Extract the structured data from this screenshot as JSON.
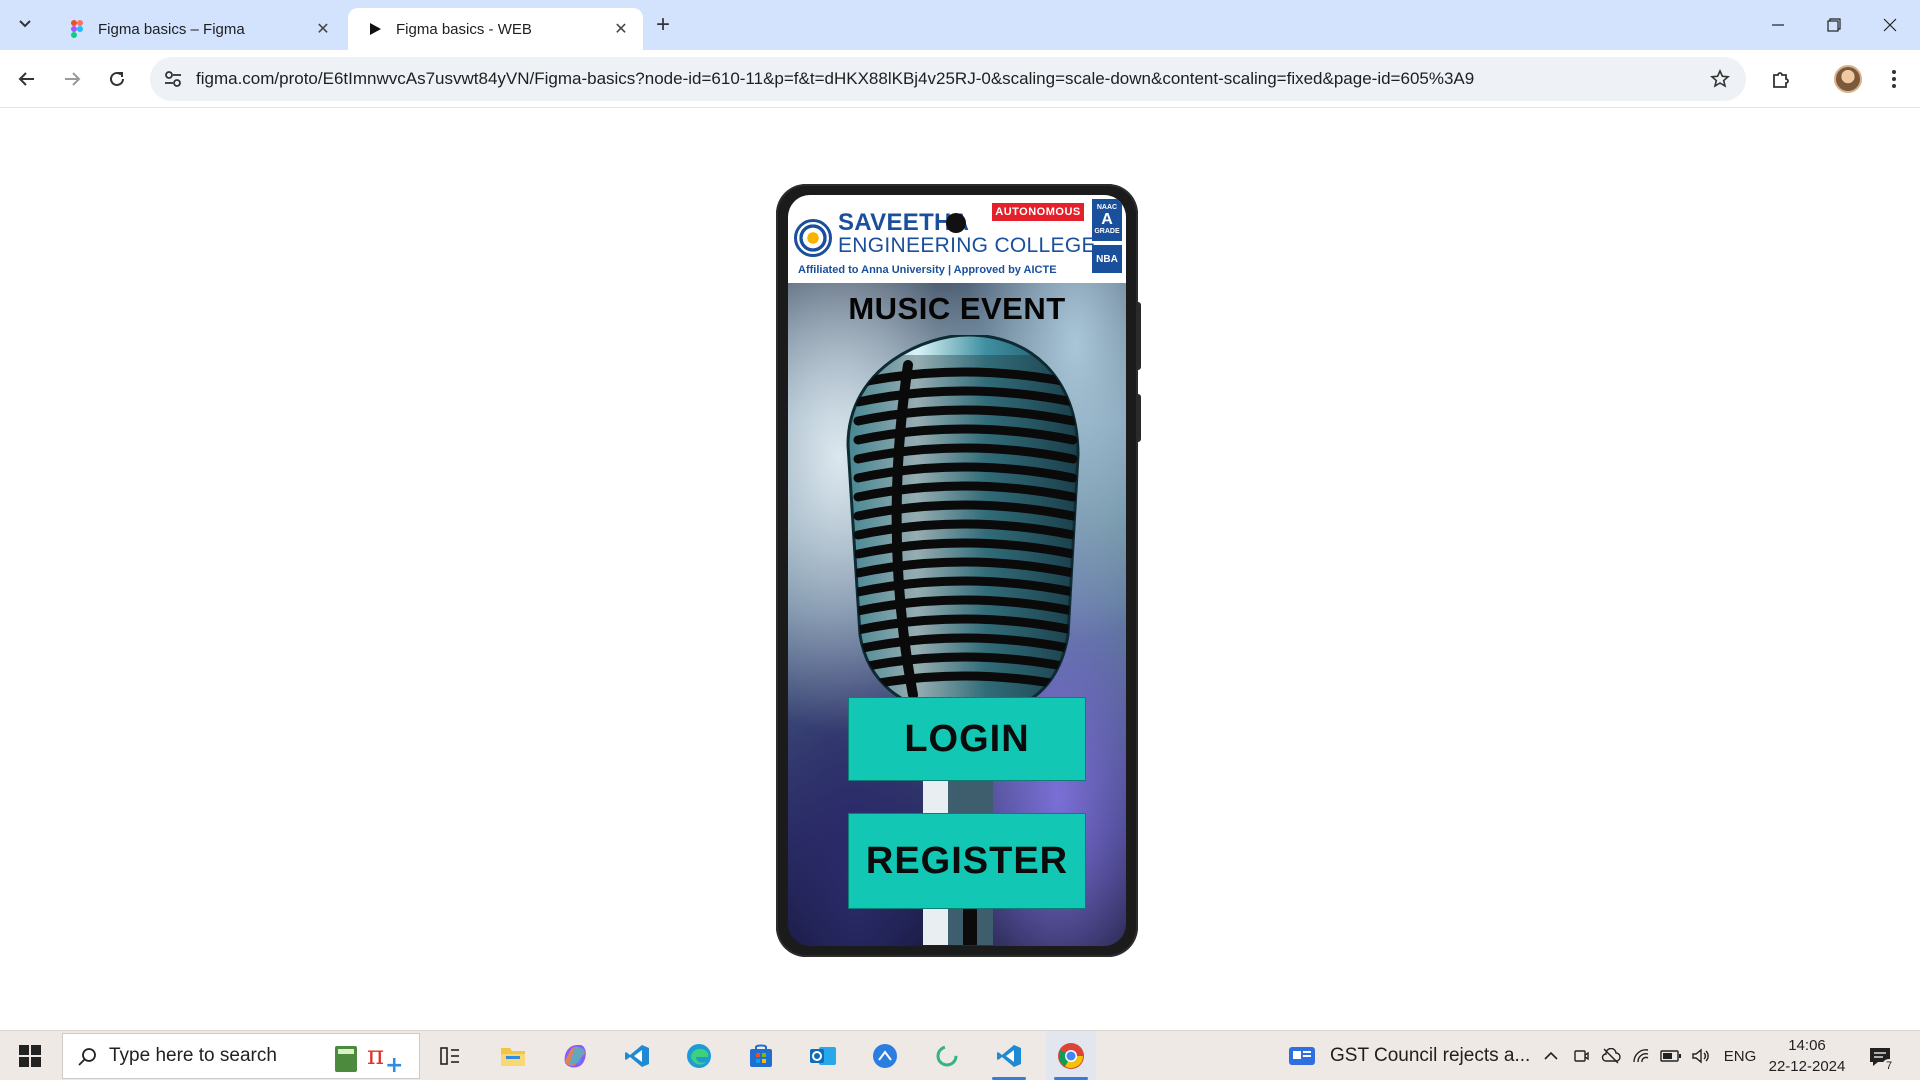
{
  "browser": {
    "tabs": [
      {
        "title": "Figma basics – Figma",
        "active": false
      },
      {
        "title": "Figma basics - WEB",
        "active": true
      }
    ],
    "url": "figma.com/proto/E6tImnwvcAs7usvwt84yVN/Figma-basics?node-id=610-11&p=f&t=dHKX88lKBj4v25RJ-0&scaling=scale-down&content-scaling=fixed&page-id=605%3A9"
  },
  "prototype": {
    "college": {
      "name_line1": "SAVEETHA",
      "name_line2": "ENGINEERING COLLEGE",
      "affiliation": "Affiliated to Anna University | Approved by AICTE",
      "badge": "AUTONOMOUS",
      "naac_label": "NAAC",
      "naac_grade": "A",
      "naac_sub": "GRADE",
      "nba_label": "NBA"
    },
    "event_title": "MUSIC EVENT",
    "login_label": "LOGIN",
    "register_label": "REGISTER",
    "accent_color": "#13c7b5"
  },
  "taskbar": {
    "search_placeholder": "Type here to search",
    "news_text": "GST Council rejects a...",
    "language": "ENG",
    "time": "14:06",
    "date": "22-12-2024",
    "notification_count": "7",
    "apps": [
      "calculator-icon",
      "task-view-icon",
      "file-explorer-icon",
      "copilot-icon",
      "vscode-icon",
      "edge-icon",
      "store-icon",
      "outlook-icon",
      "speedtest-icon",
      "loading-icon",
      "vscode-icon",
      "chrome-icon"
    ]
  }
}
